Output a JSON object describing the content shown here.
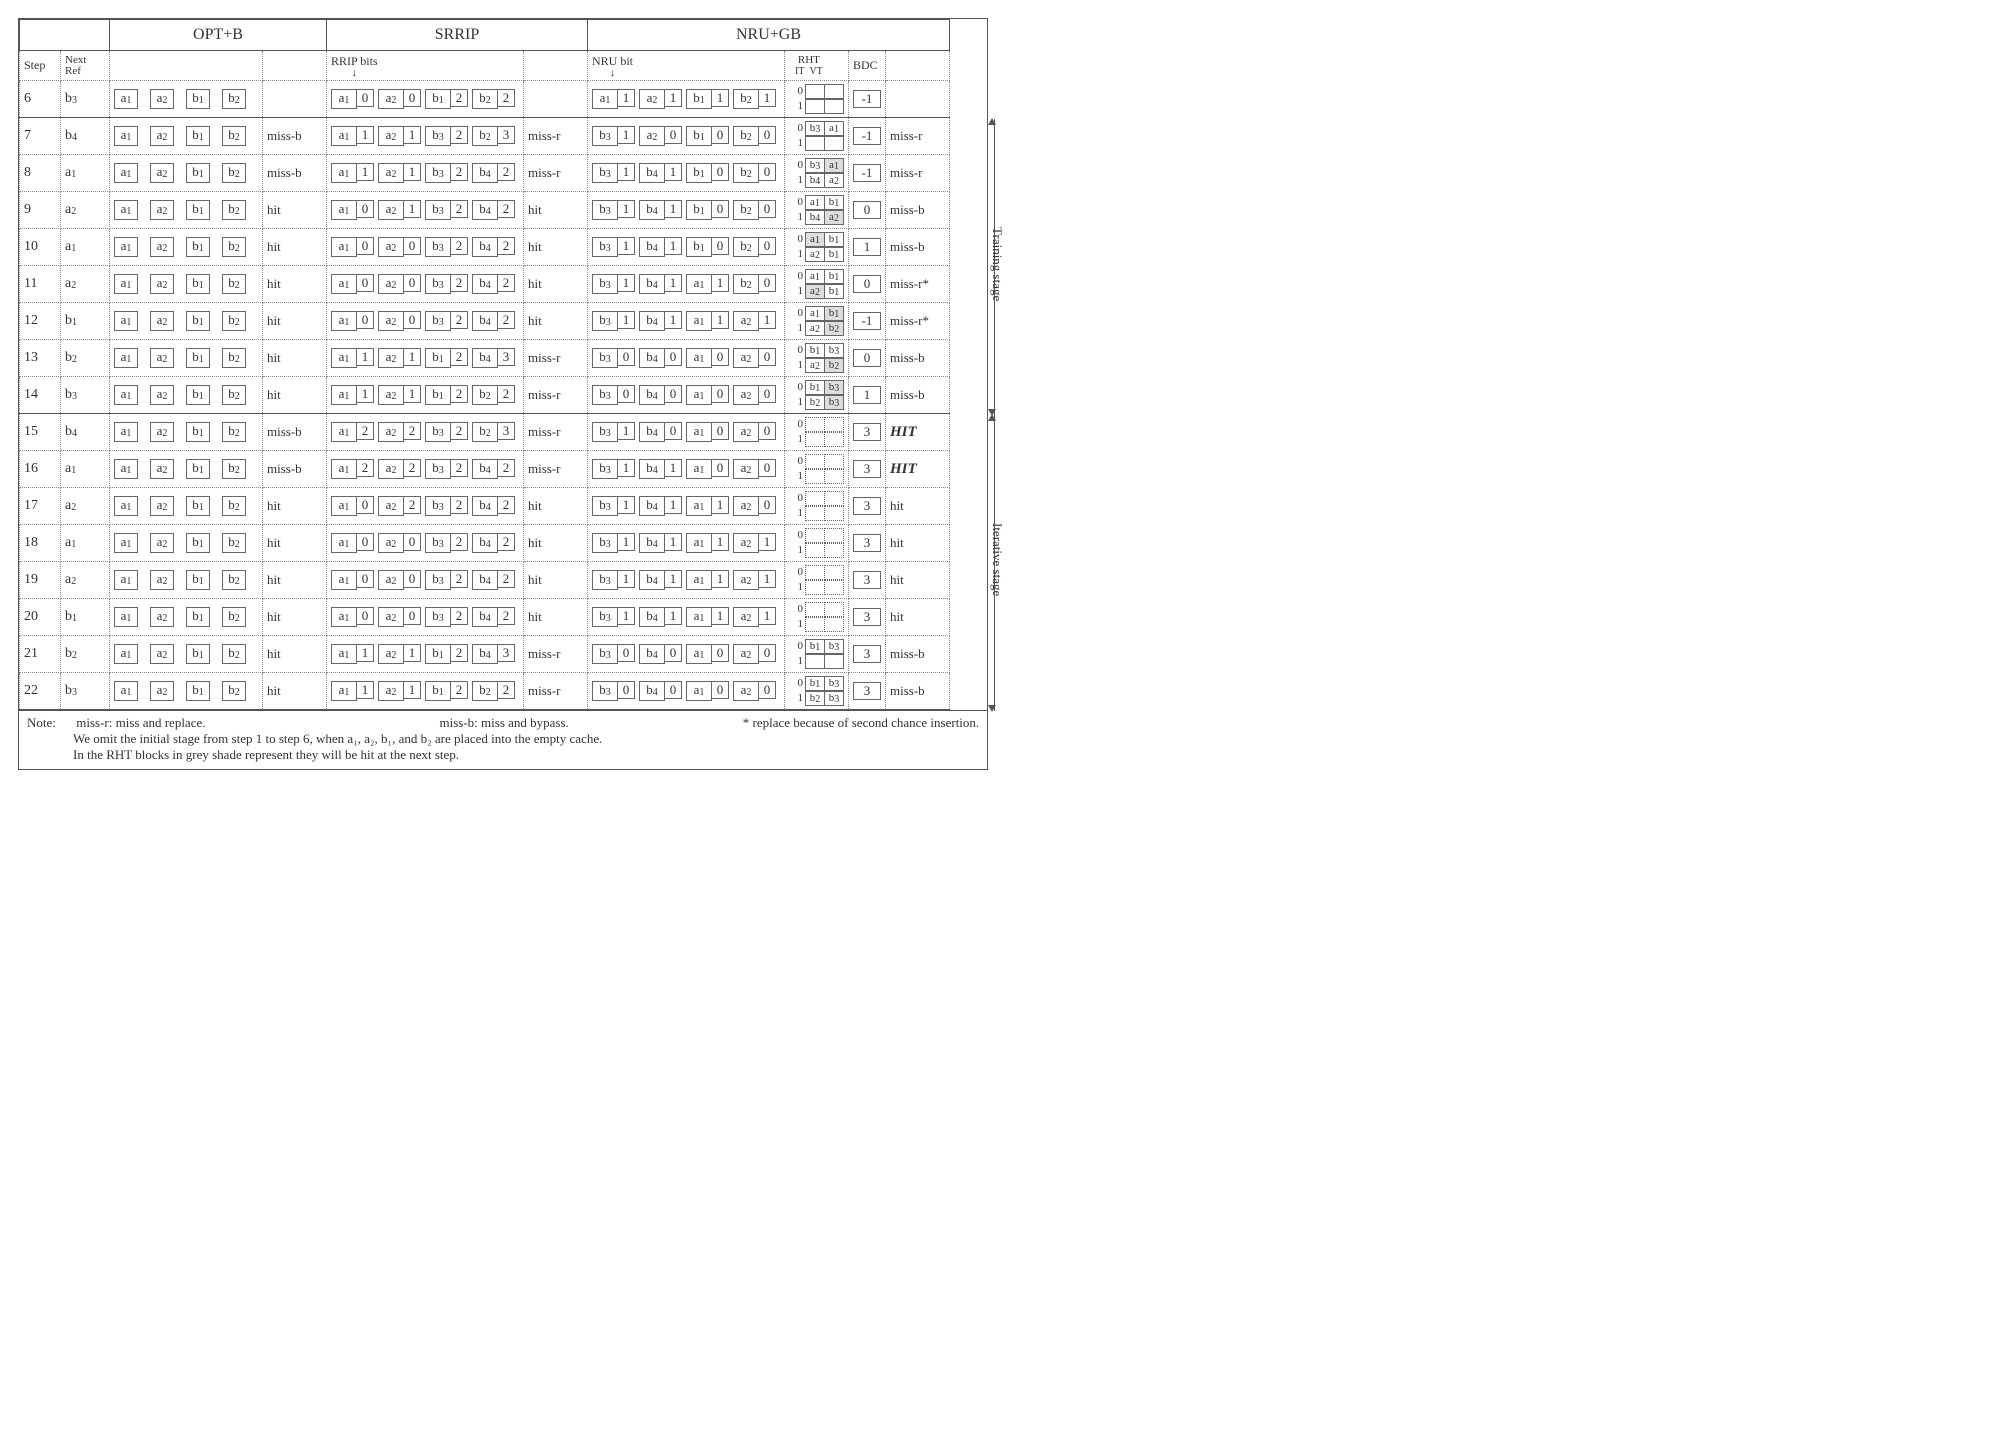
{
  "headers": {
    "opt": "OPT+B",
    "srrip": "SRRIP",
    "nru": "NRU+GB",
    "step": "Step",
    "nextref": "Next\nRef",
    "rrip_bits": "RRIP bits",
    "nru_bit": "NRU bit",
    "rht": "RHT",
    "rht_it": "IT",
    "rht_vt": "VT",
    "bdc": "BDC"
  },
  "stage_labels": {
    "train": "Training stage",
    "iter": "Iterative stage"
  },
  "rows": [
    {
      "step": 6,
      "ref": "b_3",
      "opt": {
        "c": [
          "a_1",
          "a_2",
          "b_1",
          "b_2"
        ],
        "r": ""
      },
      "sr": {
        "c": [
          [
            "a_1",
            "0"
          ],
          [
            "a_2",
            "0"
          ],
          [
            "b_1",
            "2"
          ],
          [
            "b_2",
            "2"
          ]
        ],
        "r": ""
      },
      "nr": {
        "c": [
          [
            "a_1",
            "1"
          ],
          [
            "a_2",
            "1"
          ],
          [
            "b_1",
            "1"
          ],
          [
            "b_2",
            "1"
          ]
        ],
        "rht": [
          [
            "",
            ""
          ],
          [
            "",
            ""
          ]
        ],
        "bdc": "-1",
        "r": ""
      }
    },
    {
      "step": 7,
      "ref": "b_4",
      "opt": {
        "c": [
          "a_1",
          "a_2",
          "b_1",
          "b_2"
        ],
        "r": "miss-b"
      },
      "sr": {
        "c": [
          [
            "a_1",
            "1"
          ],
          [
            "a_2",
            "1"
          ],
          [
            "b_3",
            "2"
          ],
          [
            "b_2",
            "3"
          ]
        ],
        "r": "miss-r"
      },
      "nr": {
        "c": [
          [
            "b_3",
            "1"
          ],
          [
            "a_2",
            "0"
          ],
          [
            "b_1",
            "0"
          ],
          [
            "b_2",
            "0"
          ]
        ],
        "rht": [
          [
            "b_3",
            "a_1"
          ],
          [
            "",
            ""
          ]
        ],
        "shade": [],
        "bdc": "-1",
        "r": "miss-r"
      }
    },
    {
      "step": 8,
      "ref": "a_1",
      "opt": {
        "c": [
          "a_1",
          "a_2",
          "b_1",
          "b_2"
        ],
        "r": "miss-b"
      },
      "sr": {
        "c": [
          [
            "a_1",
            "1"
          ],
          [
            "a_2",
            "1"
          ],
          [
            "b_3",
            "2"
          ],
          [
            "b_4",
            "2"
          ]
        ],
        "r": "miss-r"
      },
      "nr": {
        "c": [
          [
            "b_3",
            "1"
          ],
          [
            "b_4",
            "1"
          ],
          [
            "b_1",
            "0"
          ],
          [
            "b_2",
            "0"
          ]
        ],
        "rht": [
          [
            "b_3",
            "a_1"
          ],
          [
            "b_4",
            "a_2"
          ]
        ],
        "shade": [
          [
            0,
            1
          ]
        ],
        "bdc": "-1",
        "r": "miss-r"
      }
    },
    {
      "step": 9,
      "ref": "a_2",
      "opt": {
        "c": [
          "a_1",
          "a_2",
          "b_1",
          "b_2"
        ],
        "r": "hit"
      },
      "sr": {
        "c": [
          [
            "a_1",
            "0"
          ],
          [
            "a_2",
            "1"
          ],
          [
            "b_3",
            "2"
          ],
          [
            "b_4",
            "2"
          ]
        ],
        "r": "hit"
      },
      "nr": {
        "c": [
          [
            "b_3",
            "1"
          ],
          [
            "b_4",
            "1"
          ],
          [
            "b_1",
            "0"
          ],
          [
            "b_2",
            "0"
          ]
        ],
        "rht": [
          [
            "a_1",
            "b_1"
          ],
          [
            "b_4",
            "a_2"
          ]
        ],
        "shade": [
          [
            1,
            1
          ]
        ],
        "bdc": "0",
        "r": "miss-b"
      }
    },
    {
      "step": 10,
      "ref": "a_1",
      "opt": {
        "c": [
          "a_1",
          "a_2",
          "b_1",
          "b_2"
        ],
        "r": "hit"
      },
      "sr": {
        "c": [
          [
            "a_1",
            "0"
          ],
          [
            "a_2",
            "0"
          ],
          [
            "b_3",
            "2"
          ],
          [
            "b_4",
            "2"
          ]
        ],
        "r": "hit"
      },
      "nr": {
        "c": [
          [
            "b_3",
            "1"
          ],
          [
            "b_4",
            "1"
          ],
          [
            "b_1",
            "0"
          ],
          [
            "b_2",
            "0"
          ]
        ],
        "rht": [
          [
            "a_1",
            "b_1"
          ],
          [
            "a_2",
            "b_1"
          ]
        ],
        "shade": [
          [
            0,
            0
          ]
        ],
        "bdc": "1",
        "r": "miss-b"
      }
    },
    {
      "step": 11,
      "ref": "a_2",
      "opt": {
        "c": [
          "a_1",
          "a_2",
          "b_1",
          "b_2"
        ],
        "r": "hit"
      },
      "sr": {
        "c": [
          [
            "a_1",
            "0"
          ],
          [
            "a_2",
            "0"
          ],
          [
            "b_3",
            "2"
          ],
          [
            "b_4",
            "2"
          ]
        ],
        "r": "hit"
      },
      "nr": {
        "c": [
          [
            "b_3",
            "1"
          ],
          [
            "b_4",
            "1"
          ],
          [
            "a_1",
            "1"
          ],
          [
            "b_2",
            "0"
          ]
        ],
        "rht": [
          [
            "a_1",
            "b_1"
          ],
          [
            "a_2",
            "b_1"
          ]
        ],
        "shade": [
          [
            1,
            0
          ]
        ],
        "bdc": "0",
        "r": "miss-r*"
      }
    },
    {
      "step": 12,
      "ref": "b_1",
      "opt": {
        "c": [
          "a_1",
          "a_2",
          "b_1",
          "b_2"
        ],
        "r": "hit"
      },
      "sr": {
        "c": [
          [
            "a_1",
            "0"
          ],
          [
            "a_2",
            "0"
          ],
          [
            "b_3",
            "2"
          ],
          [
            "b_4",
            "2"
          ]
        ],
        "r": "hit"
      },
      "nr": {
        "c": [
          [
            "b_3",
            "1"
          ],
          [
            "b_4",
            "1"
          ],
          [
            "a_1",
            "1"
          ],
          [
            "a_2",
            "1"
          ]
        ],
        "rht": [
          [
            "a_1",
            "b_1"
          ],
          [
            "a_2",
            "b_2"
          ]
        ],
        "shade": [
          [
            0,
            1
          ],
          [
            1,
            1
          ]
        ],
        "bdc": "-1",
        "r": "miss-r*"
      }
    },
    {
      "step": 13,
      "ref": "b_2",
      "opt": {
        "c": [
          "a_1",
          "a_2",
          "b_1",
          "b_2"
        ],
        "r": "hit"
      },
      "sr": {
        "c": [
          [
            "a_1",
            "1"
          ],
          [
            "a_2",
            "1"
          ],
          [
            "b_1",
            "2"
          ],
          [
            "b_4",
            "3"
          ]
        ],
        "r": "miss-r"
      },
      "nr": {
        "c": [
          [
            "b_3",
            "0"
          ],
          [
            "b_4",
            "0"
          ],
          [
            "a_1",
            "0"
          ],
          [
            "a_2",
            "0"
          ]
        ],
        "rht": [
          [
            "b_1",
            "b_3"
          ],
          [
            "a_2",
            "b_2"
          ]
        ],
        "shade": [
          [
            1,
            1
          ]
        ],
        "bdc": "0",
        "r": "miss-b"
      }
    },
    {
      "step": 14,
      "ref": "b_3",
      "opt": {
        "c": [
          "a_1",
          "a_2",
          "b_1",
          "b_2"
        ],
        "r": "hit"
      },
      "sr": {
        "c": [
          [
            "a_1",
            "1"
          ],
          [
            "a_2",
            "1"
          ],
          [
            "b_1",
            "2"
          ],
          [
            "b_2",
            "2"
          ]
        ],
        "r": "miss-r"
      },
      "nr": {
        "c": [
          [
            "b_3",
            "0"
          ],
          [
            "b_4",
            "0"
          ],
          [
            "a_1",
            "0"
          ],
          [
            "a_2",
            "0"
          ]
        ],
        "rht": [
          [
            "b_1",
            "b_3"
          ],
          [
            "b_2",
            "b_3"
          ]
        ],
        "shade": [
          [
            0,
            1
          ],
          [
            1,
            1
          ]
        ],
        "bdc": "1",
        "r": "miss-b"
      }
    },
    {
      "step": 15,
      "ref": "b_4",
      "opt": {
        "c": [
          "a_1",
          "a_2",
          "b_1",
          "b_2"
        ],
        "r": "miss-b"
      },
      "sr": {
        "c": [
          [
            "a_1",
            "2"
          ],
          [
            "a_2",
            "2"
          ],
          [
            "b_3",
            "2"
          ],
          [
            "b_2",
            "3"
          ]
        ],
        "r": "miss-r"
      },
      "nr": {
        "c": [
          [
            "b_3",
            "1"
          ],
          [
            "b_4",
            "0"
          ],
          [
            "a_1",
            "0"
          ],
          [
            "a_2",
            "0"
          ]
        ],
        "rht": [
          [
            "",
            ""
          ],
          [
            "",
            ""
          ]
        ],
        "dotted": true,
        "bdc": "3",
        "r": "HIT",
        "hitEm": true
      }
    },
    {
      "step": 16,
      "ref": "a_1",
      "opt": {
        "c": [
          "a_1",
          "a_2",
          "b_1",
          "b_2"
        ],
        "r": "miss-b"
      },
      "sr": {
        "c": [
          [
            "a_1",
            "2"
          ],
          [
            "a_2",
            "2"
          ],
          [
            "b_3",
            "2"
          ],
          [
            "b_4",
            "2"
          ]
        ],
        "r": "miss-r"
      },
      "nr": {
        "c": [
          [
            "b_3",
            "1"
          ],
          [
            "b_4",
            "1"
          ],
          [
            "a_1",
            "0"
          ],
          [
            "a_2",
            "0"
          ]
        ],
        "rht": [
          [
            "",
            ""
          ],
          [
            "",
            ""
          ]
        ],
        "dotted": true,
        "bdc": "3",
        "r": "HIT",
        "hitEm": true
      }
    },
    {
      "step": 17,
      "ref": "a_2",
      "opt": {
        "c": [
          "a_1",
          "a_2",
          "b_1",
          "b_2"
        ],
        "r": "hit"
      },
      "sr": {
        "c": [
          [
            "a_1",
            "0"
          ],
          [
            "a_2",
            "2"
          ],
          [
            "b_3",
            "2"
          ],
          [
            "b_4",
            "2"
          ]
        ],
        "r": "hit"
      },
      "nr": {
        "c": [
          [
            "b_3",
            "1"
          ],
          [
            "b_4",
            "1"
          ],
          [
            "a_1",
            "1"
          ],
          [
            "a_2",
            "0"
          ]
        ],
        "rht": [
          [
            "",
            ""
          ],
          [
            "",
            ""
          ]
        ],
        "dotted": true,
        "bdc": "3",
        "r": "hit"
      }
    },
    {
      "step": 18,
      "ref": "a_1",
      "opt": {
        "c": [
          "a_1",
          "a_2",
          "b_1",
          "b_2"
        ],
        "r": "hit"
      },
      "sr": {
        "c": [
          [
            "a_1",
            "0"
          ],
          [
            "a_2",
            "0"
          ],
          [
            "b_3",
            "2"
          ],
          [
            "b_4",
            "2"
          ]
        ],
        "r": "hit"
      },
      "nr": {
        "c": [
          [
            "b_3",
            "1"
          ],
          [
            "b_4",
            "1"
          ],
          [
            "a_1",
            "1"
          ],
          [
            "a_2",
            "1"
          ]
        ],
        "rht": [
          [
            "",
            ""
          ],
          [
            "",
            ""
          ]
        ],
        "dotted": true,
        "bdc": "3",
        "r": "hit"
      }
    },
    {
      "step": 19,
      "ref": "a_2",
      "opt": {
        "c": [
          "a_1",
          "a_2",
          "b_1",
          "b_2"
        ],
        "r": "hit"
      },
      "sr": {
        "c": [
          [
            "a_1",
            "0"
          ],
          [
            "a_2",
            "0"
          ],
          [
            "b_3",
            "2"
          ],
          [
            "b_4",
            "2"
          ]
        ],
        "r": "hit"
      },
      "nr": {
        "c": [
          [
            "b_3",
            "1"
          ],
          [
            "b_4",
            "1"
          ],
          [
            "a_1",
            "1"
          ],
          [
            "a_2",
            "1"
          ]
        ],
        "rht": [
          [
            "",
            ""
          ],
          [
            "",
            ""
          ]
        ],
        "dotted": true,
        "bdc": "3",
        "r": "hit"
      }
    },
    {
      "step": 20,
      "ref": "b_1",
      "opt": {
        "c": [
          "a_1",
          "a_2",
          "b_1",
          "b_2"
        ],
        "r": "hit"
      },
      "sr": {
        "c": [
          [
            "a_1",
            "0"
          ],
          [
            "a_2",
            "0"
          ],
          [
            "b_3",
            "2"
          ],
          [
            "b_4",
            "2"
          ]
        ],
        "r": "hit"
      },
      "nr": {
        "c": [
          [
            "b_3",
            "1"
          ],
          [
            "b_4",
            "1"
          ],
          [
            "a_1",
            "1"
          ],
          [
            "a_2",
            "1"
          ]
        ],
        "rht": [
          [
            "",
            ""
          ],
          [
            "",
            ""
          ]
        ],
        "dotted": true,
        "bdc": "3",
        "r": "hit"
      }
    },
    {
      "step": 21,
      "ref": "b_2",
      "opt": {
        "c": [
          "a_1",
          "a_2",
          "b_1",
          "b_2"
        ],
        "r": "hit"
      },
      "sr": {
        "c": [
          [
            "a_1",
            "1"
          ],
          [
            "a_2",
            "1"
          ],
          [
            "b_1",
            "2"
          ],
          [
            "b_4",
            "3"
          ]
        ],
        "r": "miss-r"
      },
      "nr": {
        "c": [
          [
            "b_3",
            "0"
          ],
          [
            "b_4",
            "0"
          ],
          [
            "a_1",
            "0"
          ],
          [
            "a_2",
            "0"
          ]
        ],
        "rht": [
          [
            "b_1",
            "b_3"
          ],
          [
            "",
            ""
          ]
        ],
        "bdc": "3",
        "r": "miss-b"
      }
    },
    {
      "step": 22,
      "ref": "b_3",
      "opt": {
        "c": [
          "a_1",
          "a_2",
          "b_1",
          "b_2"
        ],
        "r": "hit"
      },
      "sr": {
        "c": [
          [
            "a_1",
            "1"
          ],
          [
            "a_2",
            "1"
          ],
          [
            "b_1",
            "2"
          ],
          [
            "b_2",
            "2"
          ]
        ],
        "r": "miss-r"
      },
      "nr": {
        "c": [
          [
            "b_3",
            "0"
          ],
          [
            "b_4",
            "0"
          ],
          [
            "a_1",
            "0"
          ],
          [
            "a_2",
            "0"
          ]
        ],
        "rht": [
          [
            "b_1",
            "b_3"
          ],
          [
            "b_2",
            "b_3"
          ]
        ],
        "bdc": "3",
        "r": "miss-b"
      }
    }
  ],
  "notes": {
    "label": "Note:",
    "n1a": "miss-r: miss and replace.",
    "n1b": "miss-b: miss and bypass.",
    "n1c": "* replace because of second chance insertion.",
    "n2": "We omit the initial stage from step 1 to step 6, when a₁, a₂, b₁, and b₂ are placed into the empty cache.",
    "n3": "In the RHT blocks in grey shade represent they will be hit at the next step."
  }
}
